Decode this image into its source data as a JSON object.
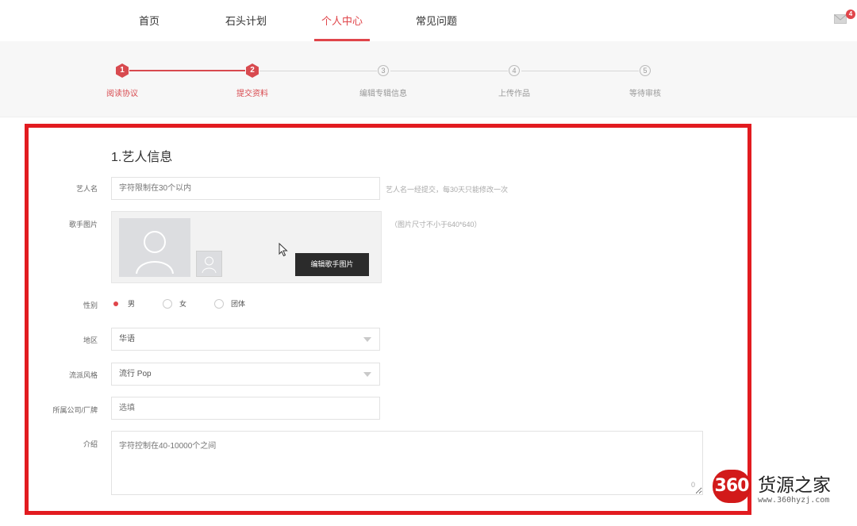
{
  "nav": {
    "items": [
      {
        "label": "首页"
      },
      {
        "label": "石头计划"
      },
      {
        "label": "个人中心",
        "active": true
      },
      {
        "label": "常见问题"
      }
    ],
    "mail_badge": "4"
  },
  "steps": [
    {
      "num": "1",
      "label": "阅读协议",
      "done": true
    },
    {
      "num": "2",
      "label": "提交资料",
      "done": true
    },
    {
      "num": "3",
      "label": "编辑专辑信息",
      "done": false
    },
    {
      "num": "4",
      "label": "上传作品",
      "done": false
    },
    {
      "num": "5",
      "label": "等待审核",
      "done": false
    }
  ],
  "form": {
    "section_title": "1.艺人信息",
    "artist_name": {
      "label": "艺人名",
      "placeholder": "字符限制在30个以内",
      "hint": "艺人名一经提交，每30天只能修改一次"
    },
    "photo": {
      "label": "歌手图片",
      "hint": "（图片尺寸不小于640*640）",
      "button": "编辑歌手图片"
    },
    "gender": {
      "label": "性别",
      "options": [
        "男",
        "女",
        "团体"
      ],
      "selected": "男"
    },
    "region": {
      "label": "地区",
      "value": "华语"
    },
    "genre": {
      "label": "流派风格",
      "value": "流行 Pop"
    },
    "company": {
      "label": "所属公司/厂牌",
      "placeholder": "选填"
    },
    "intro": {
      "label": "介绍",
      "placeholder": "字符控制在40-10000个之间",
      "count": "0"
    }
  },
  "watermark": {
    "logo": "360",
    "name": "货源之家",
    "url": "www.360hyzj.com"
  },
  "colors": {
    "accent": "#e0454a",
    "frame": "#e21b20"
  }
}
